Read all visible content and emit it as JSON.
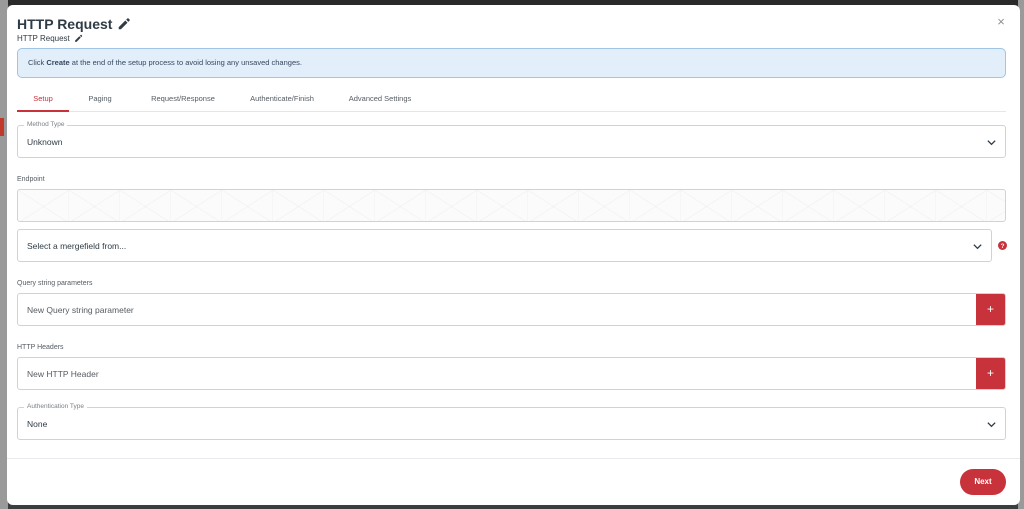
{
  "modal": {
    "title": "HTTP Request",
    "subtitle": "HTTP Request",
    "close_label": "×"
  },
  "banner": {
    "prefix": "Click ",
    "bold": "Create",
    "suffix": " at the end of the setup process to avoid losing any unsaved changes."
  },
  "tabs": [
    {
      "label": "Setup",
      "active": true
    },
    {
      "label": "Paging",
      "active": false
    },
    {
      "label": "Request/Response",
      "active": false
    },
    {
      "label": "Authenticate/Finish",
      "active": false
    },
    {
      "label": "Advanced Settings",
      "active": false
    }
  ],
  "method_type": {
    "legend": "Method Type",
    "value": "Unknown"
  },
  "endpoint": {
    "label": "Endpoint",
    "mergefield_placeholder": "Select a mergefield from..."
  },
  "query_params": {
    "label": "Query string parameters",
    "placeholder": "New Query string parameter",
    "add_label": "+"
  },
  "http_headers": {
    "label": "HTTP Headers",
    "placeholder": "New HTTP Header",
    "add_label": "+"
  },
  "auth_type": {
    "legend": "Authentication Type",
    "value": "None"
  },
  "footer": {
    "next_label": "Next"
  },
  "colors": {
    "accent": "#c7323b",
    "banner_bg": "#e2eef9",
    "banner_border": "#9fc4e6",
    "text": "#2f3b45"
  }
}
